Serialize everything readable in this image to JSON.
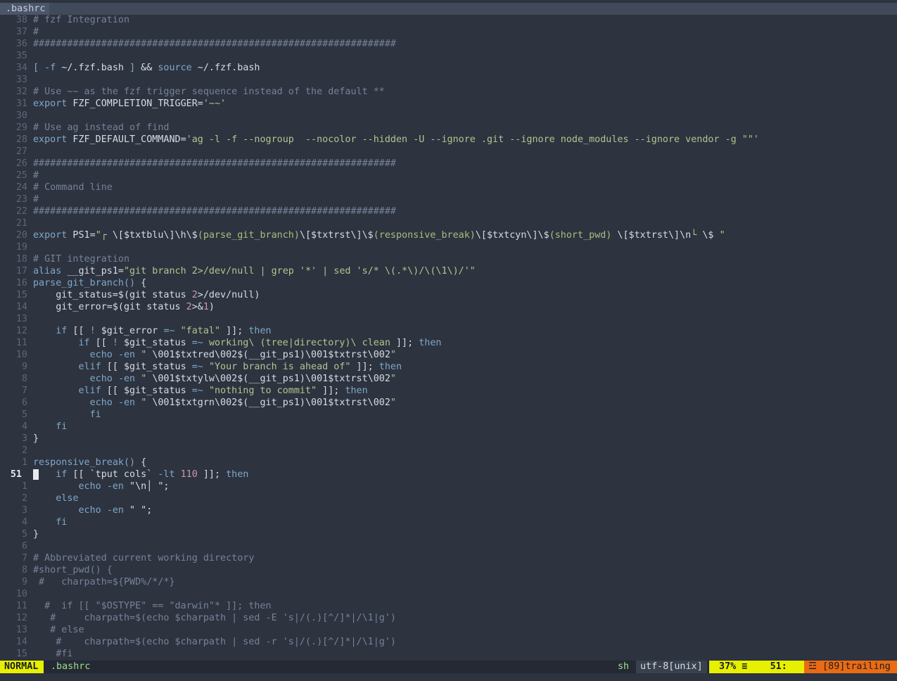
{
  "tabline": {
    "active_tab": ".bashrc"
  },
  "lines": [
    {
      "n": "38",
      "s": [
        [
          "cm",
          "# fzf Integration"
        ]
      ]
    },
    {
      "n": "37",
      "s": [
        [
          "cm",
          "#"
        ]
      ]
    },
    {
      "n": "36",
      "s": [
        [
          "cm",
          "################################################################"
        ]
      ]
    },
    {
      "n": "35",
      "s": []
    },
    {
      "n": "34",
      "s": [
        [
          "kw",
          "["
        ],
        [
          "id",
          " "
        ],
        [
          "kw",
          "-f"
        ],
        [
          "id",
          " ~/.fzf.bash "
        ],
        [
          "kw",
          "]"
        ],
        [
          "id",
          " && "
        ],
        [
          "kw",
          "source"
        ],
        [
          "id",
          " ~/.fzf.bash"
        ]
      ]
    },
    {
      "n": "33",
      "s": []
    },
    {
      "n": "32",
      "s": [
        [
          "cm",
          "# Use ~~ as the fzf trigger sequence instead of the default **"
        ]
      ]
    },
    {
      "n": "31",
      "s": [
        [
          "kw",
          "export"
        ],
        [
          "id",
          " FZF_COMPLETION_TRIGGER="
        ],
        [
          "str",
          "'~~'"
        ]
      ]
    },
    {
      "n": "30",
      "s": []
    },
    {
      "n": "29",
      "s": [
        [
          "cm",
          "# Use ag instead of find"
        ]
      ]
    },
    {
      "n": "28",
      "s": [
        [
          "kw",
          "export"
        ],
        [
          "id",
          " FZF_DEFAULT_COMMAND="
        ],
        [
          "str",
          "'ag -l -f --nogroup  --nocolor --hidden -U --ignore .git --ignore node_modules --ignore vendor -g \"\"'"
        ]
      ]
    },
    {
      "n": "27",
      "s": []
    },
    {
      "n": "26",
      "s": [
        [
          "cm",
          "################################################################"
        ]
      ]
    },
    {
      "n": "25",
      "s": [
        [
          "cm",
          "#"
        ]
      ]
    },
    {
      "n": "24",
      "s": [
        [
          "cm",
          "# Command line"
        ]
      ]
    },
    {
      "n": "23",
      "s": [
        [
          "cm",
          "#"
        ]
      ]
    },
    {
      "n": "22",
      "s": [
        [
          "cm",
          "################################################################"
        ]
      ]
    },
    {
      "n": "21",
      "s": []
    },
    {
      "n": "20",
      "s": [
        [
          "kw",
          "export"
        ],
        [
          "id",
          " PS1="
        ],
        [
          "str",
          "\"┌ "
        ],
        [
          "id",
          "\\[$txtblu\\]\\h\\$"
        ],
        [
          "fn",
          "(parse_git_branch)"
        ],
        [
          "id",
          "\\[$txtrst\\]\\$"
        ],
        [
          "fn",
          "(responsive_break)"
        ],
        [
          "id",
          "\\[$txtcyn\\]\\$"
        ],
        [
          "fn",
          "(short_pwd)"
        ],
        [
          "id",
          " \\[$txtrst\\]\\n"
        ],
        [
          "str",
          "└ "
        ],
        [
          "id",
          "\\$ "
        ],
        [
          "str",
          "\""
        ]
      ]
    },
    {
      "n": "19",
      "s": []
    },
    {
      "n": "18",
      "s": [
        [
          "cm",
          "# GIT integration"
        ]
      ]
    },
    {
      "n": "17",
      "s": [
        [
          "kw",
          "alias"
        ],
        [
          "id",
          " __git_ps1="
        ],
        [
          "str",
          "\"git branch 2>/dev/null | grep '*' | sed 's/* \\(.*\\)/\\(\\1\\)/'\""
        ]
      ]
    },
    {
      "n": "16",
      "s": [
        [
          "kw",
          "parse_git_branch()"
        ],
        [
          "id",
          " {"
        ]
      ]
    },
    {
      "n": "15",
      "s": [
        [
          "id",
          "    git_status=$(git status "
        ],
        [
          "num",
          "2"
        ],
        [
          "id",
          ">/dev/null)"
        ]
      ]
    },
    {
      "n": "14",
      "s": [
        [
          "id",
          "    git_error=$(git status "
        ],
        [
          "num",
          "2"
        ],
        [
          "id",
          ">&"
        ],
        [
          "num",
          "1"
        ],
        [
          "id",
          ")"
        ]
      ]
    },
    {
      "n": "13",
      "s": []
    },
    {
      "n": "12",
      "s": [
        [
          "id",
          "    "
        ],
        [
          "kw",
          "if"
        ],
        [
          "id",
          " [[ "
        ],
        [
          "kw",
          "!"
        ],
        [
          "id",
          " $git_error "
        ],
        [
          "kw",
          "=~"
        ],
        [
          "id",
          " "
        ],
        [
          "str",
          "\"fatal\""
        ],
        [
          "id",
          " ]]; "
        ],
        [
          "kw",
          "then"
        ]
      ]
    },
    {
      "n": "11",
      "s": [
        [
          "id",
          "        "
        ],
        [
          "kw",
          "if"
        ],
        [
          "id",
          " [[ "
        ],
        [
          "kw",
          "!"
        ],
        [
          "id",
          " $git_status "
        ],
        [
          "kw",
          "=~"
        ],
        [
          "id",
          " "
        ],
        [
          "str",
          "working\\ (tree|directory)\\ clean"
        ],
        [
          "id",
          " ]]; "
        ],
        [
          "kw",
          "then"
        ]
      ]
    },
    {
      "n": "10",
      "s": [
        [
          "id",
          "          "
        ],
        [
          "kw",
          "echo"
        ],
        [
          "id",
          " "
        ],
        [
          "kw",
          "-en"
        ],
        [
          "id",
          " "
        ],
        [
          "str",
          "\" "
        ],
        [
          "id",
          "\\001$txtred\\002$(__git_ps1)\\001$txtrst\\002"
        ],
        [
          "str",
          "\""
        ]
      ]
    },
    {
      "n": "9",
      "s": [
        [
          "id",
          "        "
        ],
        [
          "kw",
          "elif"
        ],
        [
          "id",
          " [[ $git_status "
        ],
        [
          "kw",
          "=~"
        ],
        [
          "id",
          " "
        ],
        [
          "str",
          "\"Your branch is ahead of\""
        ],
        [
          "id",
          " ]]; "
        ],
        [
          "kw",
          "then"
        ]
      ]
    },
    {
      "n": "8",
      "s": [
        [
          "id",
          "          "
        ],
        [
          "kw",
          "echo"
        ],
        [
          "id",
          " "
        ],
        [
          "kw",
          "-en"
        ],
        [
          "id",
          " "
        ],
        [
          "str",
          "\" "
        ],
        [
          "id",
          "\\001$txtylw\\002$(__git_ps1)\\001$txtrst\\002"
        ],
        [
          "str",
          "\""
        ]
      ]
    },
    {
      "n": "7",
      "s": [
        [
          "id",
          "        "
        ],
        [
          "kw",
          "elif"
        ],
        [
          "id",
          " [[ $git_status "
        ],
        [
          "kw",
          "=~"
        ],
        [
          "id",
          " "
        ],
        [
          "str",
          "\"nothing to commit\""
        ],
        [
          "id",
          " ]]; "
        ],
        [
          "kw",
          "then"
        ]
      ]
    },
    {
      "n": "6",
      "s": [
        [
          "id",
          "          "
        ],
        [
          "kw",
          "echo"
        ],
        [
          "id",
          " "
        ],
        [
          "kw",
          "-en"
        ],
        [
          "id",
          " "
        ],
        [
          "str",
          "\" "
        ],
        [
          "id",
          "\\001$txtgrn\\002$(__git_ps1)\\001$txtrst\\002"
        ],
        [
          "str",
          "\""
        ]
      ]
    },
    {
      "n": "5",
      "s": [
        [
          "id",
          "          "
        ],
        [
          "kw",
          "fi"
        ]
      ]
    },
    {
      "n": "4",
      "s": [
        [
          "id",
          "    "
        ],
        [
          "kw",
          "fi"
        ]
      ]
    },
    {
      "n": "3",
      "s": [
        [
          "id",
          "}"
        ]
      ]
    },
    {
      "n": "2",
      "s": []
    },
    {
      "n": "1",
      "s": [
        [
          "kw",
          "responsive_break()"
        ],
        [
          "id",
          " {"
        ]
      ]
    },
    {
      "n": "51",
      "cur": true,
      "s": [
        [
          "id",
          "    "
        ],
        [
          "kw",
          "if"
        ],
        [
          "id",
          " [[ `tput cols` "
        ],
        [
          "kw",
          "-lt"
        ],
        [
          "id",
          " "
        ],
        [
          "num",
          "110"
        ],
        [
          "id",
          " ]]; "
        ],
        [
          "kw",
          "then"
        ]
      ]
    },
    {
      "n": "1",
      "s": [
        [
          "id",
          "        "
        ],
        [
          "kw",
          "echo"
        ],
        [
          "id",
          " "
        ],
        [
          "kw",
          "-en"
        ],
        [
          "id",
          " \"\\n│ \";"
        ]
      ]
    },
    {
      "n": "2",
      "s": [
        [
          "id",
          "    "
        ],
        [
          "kw",
          "else"
        ]
      ]
    },
    {
      "n": "3",
      "s": [
        [
          "id",
          "        "
        ],
        [
          "kw",
          "echo"
        ],
        [
          "id",
          " "
        ],
        [
          "kw",
          "-en"
        ],
        [
          "id",
          " \" \";"
        ]
      ]
    },
    {
      "n": "4",
      "s": [
        [
          "id",
          "    "
        ],
        [
          "kw",
          "fi"
        ]
      ]
    },
    {
      "n": "5",
      "s": [
        [
          "id",
          "}"
        ]
      ]
    },
    {
      "n": "6",
      "s": []
    },
    {
      "n": "7",
      "s": [
        [
          "cm",
          "# Abbreviated current working directory"
        ]
      ]
    },
    {
      "n": "8",
      "s": [
        [
          "cm",
          "#short_pwd() {"
        ]
      ]
    },
    {
      "n": "9",
      "s": [
        [
          "cm",
          " #   charpath=${PWD%/*/*}"
        ]
      ]
    },
    {
      "n": "10",
      "s": []
    },
    {
      "n": "11",
      "s": [
        [
          "cm",
          "  #  if [[ \"$OSTYPE\" == \"darwin\"* ]]; then"
        ]
      ]
    },
    {
      "n": "12",
      "s": [
        [
          "cm",
          "   #     charpath=$(echo $charpath | sed -E 's|/(.)[^/]*|/\\1|g')"
        ]
      ]
    },
    {
      "n": "13",
      "s": [
        [
          "cm",
          "   # else"
        ]
      ]
    },
    {
      "n": "14",
      "s": [
        [
          "cm",
          "    #    charpath=$(echo $charpath | sed -r 's|/(.)[^/]*|/\\1|g')"
        ]
      ]
    },
    {
      "n": "15",
      "s": [
        [
          "cm",
          "    #fi"
        ]
      ]
    }
  ],
  "statusline": {
    "mode": "NORMAL",
    "file": ".bashrc",
    "filetype": "sh",
    "encoding": "utf-8[unix]",
    "position": " 37% ≡    51:   1",
    "warning": "☲ [89]trailing"
  },
  "colors": {
    "background": "#2d333f",
    "mode_bg": "#e6f000",
    "warning_bg": "#ea6b14"
  }
}
